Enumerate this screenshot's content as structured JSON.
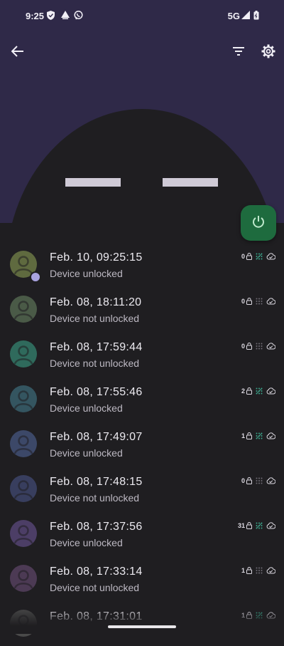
{
  "status_bar": {
    "time": "9:25",
    "network": "5G"
  },
  "colors": {
    "header": "#2f2948",
    "background": "#1f1e21",
    "power_button": "#1e6b3e",
    "pattern_accent": "#3ca58a"
  },
  "entries": [
    {
      "timestamp": "Feb. 10, 09:25:15",
      "status": "Device unlocked",
      "count": "0",
      "pattern": true,
      "avatar_color": "#5f6a3f",
      "badge": true
    },
    {
      "timestamp": "Feb. 08, 18:11:20",
      "status": "Device not unlocked",
      "count": "0",
      "pattern": false,
      "avatar_color": "#4a5a47",
      "badge": false
    },
    {
      "timestamp": "Feb. 08, 17:59:44",
      "status": "Device not unlocked",
      "count": "0",
      "pattern": false,
      "avatar_color": "#2f6a5c",
      "badge": false
    },
    {
      "timestamp": "Feb. 08, 17:55:46",
      "status": "Device unlocked",
      "count": "2",
      "pattern": true,
      "avatar_color": "#345560",
      "badge": false
    },
    {
      "timestamp": "Feb. 08, 17:49:07",
      "status": "Device unlocked",
      "count": "1",
      "pattern": true,
      "avatar_color": "#3c4868",
      "badge": false
    },
    {
      "timestamp": "Feb. 08, 17:48:15",
      "status": "Device not unlocked",
      "count": "0",
      "pattern": false,
      "avatar_color": "#383e5e",
      "badge": false
    },
    {
      "timestamp": "Feb. 08, 17:37:56",
      "status": "Device unlocked",
      "count": "31",
      "pattern": true,
      "avatar_color": "#4c3e66",
      "badge": false
    },
    {
      "timestamp": "Feb. 08, 17:33:14",
      "status": "Device not unlocked",
      "count": "1",
      "pattern": false,
      "avatar_color": "#4c3a54",
      "badge": false
    },
    {
      "timestamp": "Feb. 08, 17:31:01",
      "status": "",
      "count": "1",
      "pattern": true,
      "avatar_color": "#4a4a4a",
      "badge": false
    }
  ],
  "icons": {
    "back": "arrow-back-icon",
    "filter": "filter-icon",
    "settings": "gear-icon",
    "power": "power-icon",
    "lock": "lock-icon",
    "pattern": "pattern-grid-icon",
    "cloud": "cloud-sync-icon"
  }
}
